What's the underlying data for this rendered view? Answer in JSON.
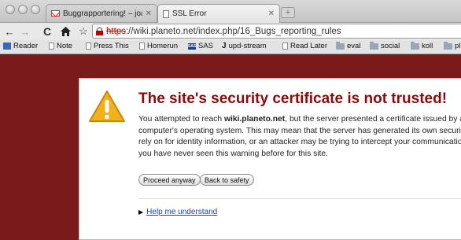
{
  "tabs": [
    {
      "title": "Buggrapportering! – joakim",
      "icon": "gmail-icon",
      "active": false
    },
    {
      "title": "SSL Error",
      "icon": "document-icon",
      "active": true
    }
  ],
  "toolbar": {
    "url_scheme": "https",
    "url_rest": "://wiki.planeto.net/index.php/16_Bugs_reporting_rules"
  },
  "bookmarks": [
    {
      "label": "Reader",
      "icon": "reader-icon"
    },
    {
      "label": "Note",
      "icon": "document-icon"
    },
    {
      "label": "Press This",
      "icon": "document-icon"
    },
    {
      "label": "Homerun",
      "icon": "document-icon"
    },
    {
      "label": "SAS",
      "icon": "sas-icon"
    },
    {
      "label": "upd-stream",
      "icon": "j-icon"
    },
    {
      "label": "Read Later",
      "icon": "document-icon"
    },
    {
      "label": "eval",
      "icon": "folder-icon"
    },
    {
      "label": "social",
      "icon": "folder-icon"
    },
    {
      "label": "koll",
      "icon": "folder-icon"
    },
    {
      "label": "pl",
      "icon": "folder-icon"
    }
  ],
  "error": {
    "heading": "The site's security certificate is not trusted!",
    "para_prefix": "You attempted to reach ",
    "host": "wiki.planeto.net",
    "para_line1_rest": ", but the server presented a certificate issued by an e",
    "line2": "computer's operating system. This may mean that the server has generated its own security cr",
    "line3": "rely on for identity information, or an attacker may be trying to intercept your communications. Y",
    "line4": "you have never seen this warning before for this site.",
    "proceed_label": "Proceed anyway",
    "back_label": "Back to safety",
    "help_label": "Help me understand"
  },
  "colors": {
    "page_background": "#7a1a1a",
    "heading": "#8a0b0b",
    "link": "#1a3fbf",
    "warning_icon": "#f0b11a"
  }
}
